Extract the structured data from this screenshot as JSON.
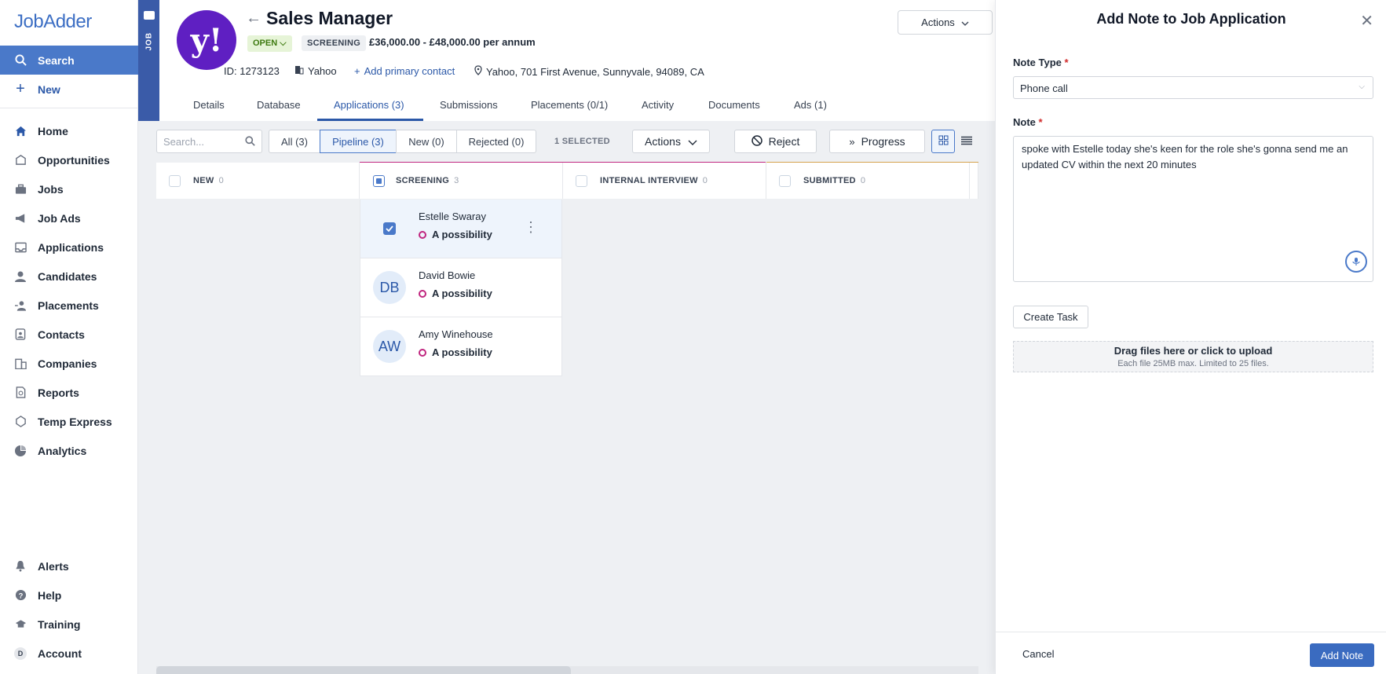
{
  "app": {
    "name": "JobAdder"
  },
  "sidebar": {
    "search": "Search",
    "new": "New",
    "items": [
      {
        "label": "Home",
        "icon": "home-icon"
      },
      {
        "label": "Opportunities",
        "icon": "opportunities-icon"
      },
      {
        "label": "Jobs",
        "icon": "briefcase-icon"
      },
      {
        "label": "Job Ads",
        "icon": "megaphone-icon"
      },
      {
        "label": "Applications",
        "icon": "inbox-icon"
      },
      {
        "label": "Candidates",
        "icon": "person-icon"
      },
      {
        "label": "Placements",
        "icon": "placement-icon"
      },
      {
        "label": "Contacts",
        "icon": "contacts-icon"
      },
      {
        "label": "Companies",
        "icon": "building-icon"
      },
      {
        "label": "Reports",
        "icon": "report-icon"
      },
      {
        "label": "Temp Express",
        "icon": "temp-icon"
      },
      {
        "label": "Analytics",
        "icon": "pie-chart-icon"
      }
    ],
    "bottom": [
      {
        "label": "Alerts",
        "icon": "bell-icon"
      },
      {
        "label": "Help",
        "icon": "help-icon"
      },
      {
        "label": "Training",
        "icon": "graduation-cap-icon"
      },
      {
        "label": "Account",
        "icon": "account-avatar",
        "avatar_letter": "D"
      }
    ]
  },
  "job": {
    "stripe_label": "JOB",
    "logo_letter": "y!",
    "title": "Sales Manager",
    "status": "OPEN",
    "stage": "SCREENING",
    "salary": "£36,000.00 - £48,000.00 per annum",
    "id": "ID: 1273123",
    "company": "Yahoo",
    "add_contact": "Add primary contact",
    "location": "Yahoo, 701 First Avenue, Sunnyvale, 94089, CA",
    "actions": "Actions"
  },
  "tabs": [
    "Details",
    "Database",
    "Applications (3)",
    "Submissions",
    "Placements (0/1)",
    "Activity",
    "Documents",
    "Ads (1)"
  ],
  "toolbar": {
    "search_placeholder": "Search...",
    "filters": [
      "All (3)",
      "Pipeline (3)",
      "New (0)",
      "Rejected (0)"
    ],
    "selected": "1 SELECTED",
    "actions": "Actions",
    "reject": "Reject",
    "progress": "Progress"
  },
  "columns": [
    {
      "name": "NEW",
      "count": "0",
      "color": ""
    },
    {
      "name": "SCREENING",
      "count": "3",
      "color": "#c0267f"
    },
    {
      "name": "INTERNAL INTERVIEW",
      "count": "0",
      "color": "#c0267f"
    },
    {
      "name": "SUBMITTED",
      "count": "0",
      "color": "#d4a24c"
    }
  ],
  "candidates": [
    {
      "name": "Estelle Swaray",
      "status": "A possibility",
      "initials": "",
      "selected": true
    },
    {
      "name": "David Bowie",
      "status": "A possibility",
      "initials": "DB",
      "selected": false
    },
    {
      "name": "Amy Winehouse",
      "status": "A possibility",
      "initials": "AW",
      "selected": false
    }
  ],
  "panel": {
    "title": "Add Note to Job Application",
    "note_type_label": "Note Type",
    "note_type_value": "Phone call",
    "note_label": "Note",
    "note_text": " spoke with Estelle today she's keen for the role she's gonna send me an updated CV within the next 20 minutes",
    "create_task": "Create Task",
    "upload_title": "Drag files here or click to upload",
    "upload_sub": "Each file 25MB max. Limited to 25 files.",
    "cancel": "Cancel",
    "submit": "Add Note"
  },
  "colors": {
    "accent": "#4a79c9",
    "brand": "#3d6fc4",
    "yahoo": "#5f1fc2"
  }
}
